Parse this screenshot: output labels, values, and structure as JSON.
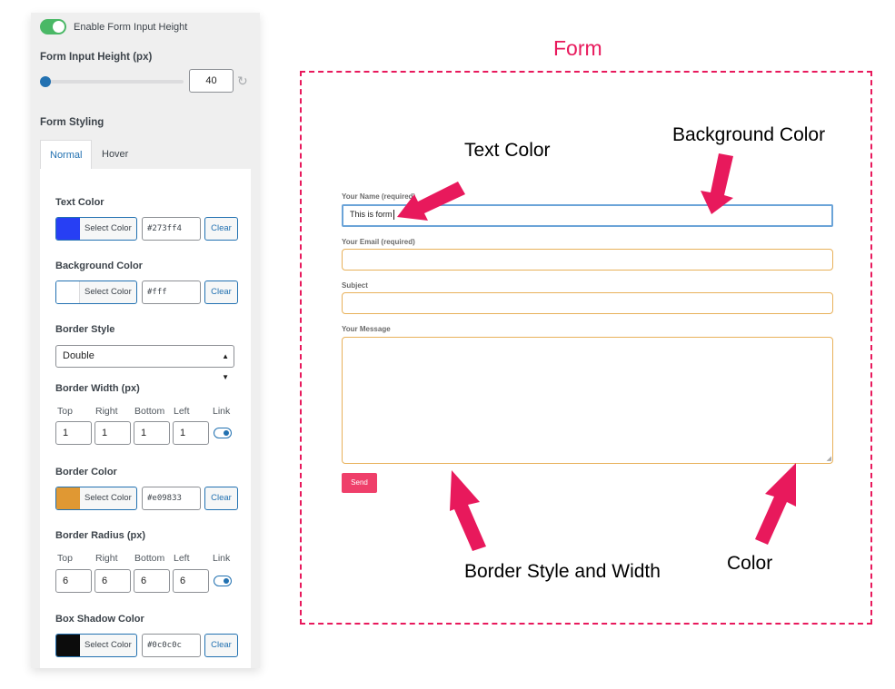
{
  "panel": {
    "enable_height_toggle": {
      "label": "Enable Form Input Height",
      "on": true
    },
    "input_height": {
      "label": "Form Input Height (px)",
      "value": "40",
      "slider_fraction": 0.0,
      "reset_icon": "reset-icon"
    },
    "form_styling_title": "Form Styling",
    "tabs": [
      {
        "label": "Normal",
        "active": true
      },
      {
        "label": "Hover",
        "active": false
      }
    ],
    "text_color": {
      "label": "Text Color",
      "select_label": "Select Color",
      "hex": "#273ff4",
      "swatch": "#273ff4",
      "clear_label": "Clear"
    },
    "background_color": {
      "label": "Background Color",
      "select_label": "Select Color",
      "hex": "#fff",
      "swatch": "#ffffff",
      "clear_label": "Clear"
    },
    "border_style": {
      "label": "Border Style",
      "selected": "Double"
    },
    "border_width": {
      "label": "Border Width (px)",
      "sides": [
        "Top",
        "Right",
        "Bottom",
        "Left"
      ],
      "values": [
        "1",
        "1",
        "1",
        "1"
      ],
      "link_label": "Link",
      "linked": true
    },
    "border_color": {
      "label": "Border Color",
      "select_label": "Select Color",
      "hex": "#e09833",
      "swatch": "#e09833",
      "clear_label": "Clear"
    },
    "border_radius": {
      "label": "Border Radius (px)",
      "sides": [
        "Top",
        "Right",
        "Bottom",
        "Left"
      ],
      "values": [
        "6",
        "6",
        "6",
        "6"
      ],
      "link_label": "Link",
      "linked": true
    },
    "box_shadow_color": {
      "label": "Box Shadow Color",
      "select_label": "Select Color",
      "hex": "#0c0c0c",
      "swatch": "#0c0c0c",
      "clear_label": "Clear"
    }
  },
  "preview": {
    "caption": "Form",
    "fields": [
      {
        "label": "Your Name (required)",
        "value": "This is form",
        "focused": true
      },
      {
        "label": "Your Email (required)",
        "value": ""
      },
      {
        "label": "Subject",
        "value": ""
      }
    ],
    "message_label": "Your Message",
    "send_label": "Send",
    "annotations": {
      "text_color": "Text Color",
      "background_color": "Background Color",
      "border_style_width": "Border Style and Width",
      "color": "Color"
    },
    "accent_color": "#e8195c"
  }
}
